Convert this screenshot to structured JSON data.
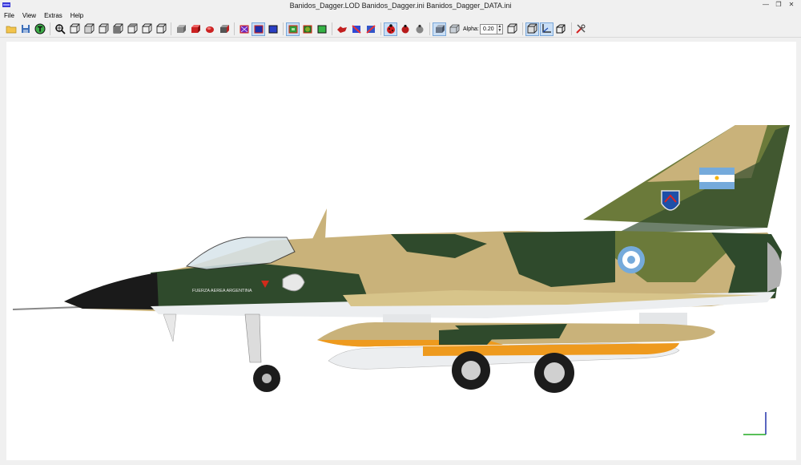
{
  "window": {
    "title": "Banidos_Dagger.LOD  Banidos_Dagger.ini  Banidos_Dagger_DATA.ini",
    "minimize_glyph": "—",
    "restore_glyph": "❐",
    "close_glyph": "✕"
  },
  "menu": {
    "items": [
      "File",
      "View",
      "Extras",
      "Help"
    ]
  },
  "toolbar": {
    "alpha_label": "Alpha:",
    "alpha_value": "0.20",
    "spin_up": "▲",
    "spin_down": "▼"
  },
  "viewport": {
    "background": "#ffffff",
    "fuselage_text": "FUERZA AEREA ARGENTINA"
  },
  "colors": {
    "camo_green": "#2f4a2c",
    "camo_olive": "#6b7a3a",
    "camo_tan": "#c9b27a",
    "belly_white": "#eceef0",
    "tank_orange": "#ee9a1e",
    "nose_black": "#1a1a1a",
    "toolbar_active": "#c9def5"
  }
}
